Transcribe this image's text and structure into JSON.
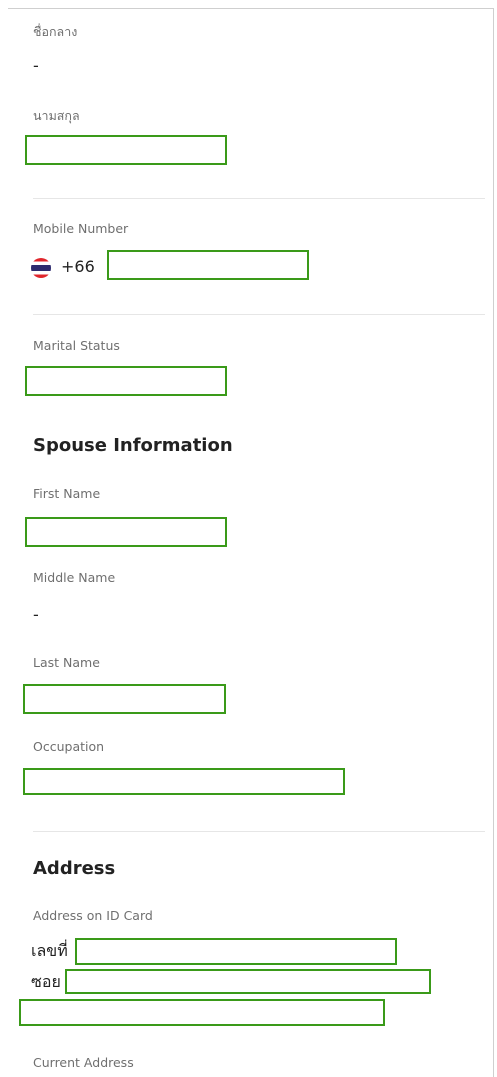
{
  "personal": {
    "middle_name_label_th": "ชื่อกลาง",
    "middle_name_value": "-",
    "surname_label_th": "นามสกุล"
  },
  "mobile": {
    "label": "Mobile Number",
    "country_code": "+66",
    "flag_icon": "thailand-flag-icon"
  },
  "marital": {
    "label": "Marital Status"
  },
  "spouse": {
    "heading": "Spouse Information",
    "first_name_label": "First Name",
    "middle_name_label": "Middle Name",
    "middle_name_value": "-",
    "last_name_label": "Last Name",
    "occupation_label": "Occupation"
  },
  "address": {
    "heading": "Address",
    "id_card_label": "Address on ID Card",
    "house_no_prefix": "เลขที่",
    "soi_prefix": "ซอย",
    "current_label": "Current Address"
  },
  "colors": {
    "redaction_border": "#3a9a19",
    "label_text": "#6f6f6f",
    "divider": "#e6e6e6"
  }
}
